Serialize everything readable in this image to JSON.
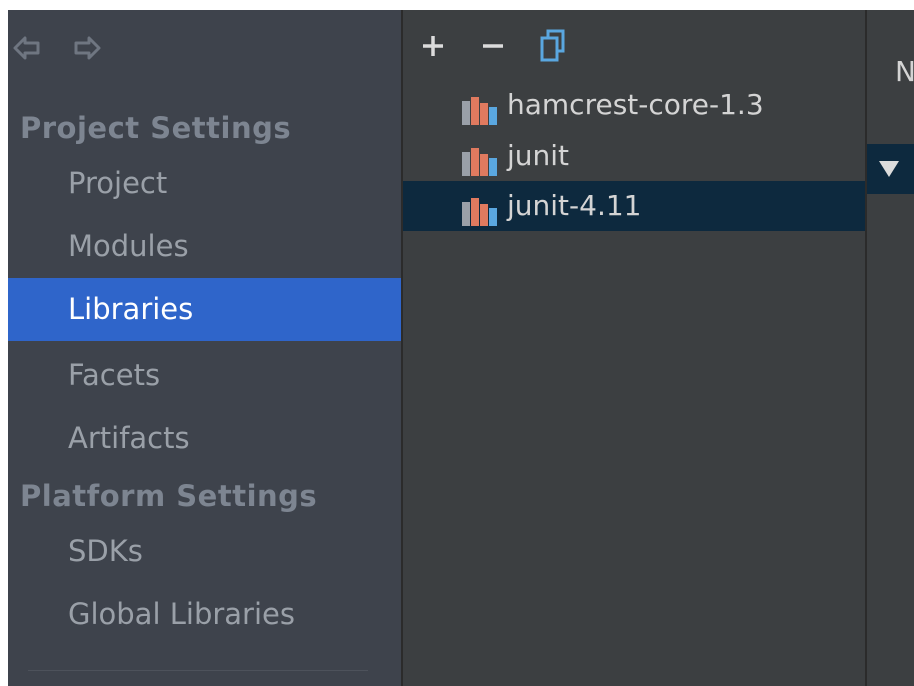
{
  "sidebar": {
    "sections": [
      {
        "title": "Project Settings",
        "items": [
          {
            "label": "Project",
            "selected": false
          },
          {
            "label": "Modules",
            "selected": false
          },
          {
            "label": "Libraries",
            "selected": true
          },
          {
            "label": "Facets",
            "selected": false
          },
          {
            "label": "Artifacts",
            "selected": false
          }
        ]
      },
      {
        "title": "Platform Settings",
        "items": [
          {
            "label": "SDKs",
            "selected": false
          },
          {
            "label": "Global Libraries",
            "selected": false
          }
        ]
      }
    ],
    "nav": {
      "back_icon": "back-arrow-icon",
      "forward_icon": "forward-arrow-icon"
    }
  },
  "toolbar": {
    "add_icon": "plus-icon",
    "remove_icon": "minus-icon",
    "copy_icon": "copy-icon"
  },
  "libraries": [
    {
      "name": "hamcrest-core-1.3",
      "selected": false
    },
    {
      "name": "junit",
      "selected": false
    },
    {
      "name": "junit-4.11",
      "selected": true
    }
  ],
  "details": {
    "name_label_fragment": "N",
    "tree_toggle_icon": "triangle-down-icon"
  },
  "colors": {
    "sidebar_bg": "#3e434c",
    "selection_blue": "#2f65ca",
    "selection_dark": "#0d293e",
    "panel_bg": "#3c3f41"
  }
}
